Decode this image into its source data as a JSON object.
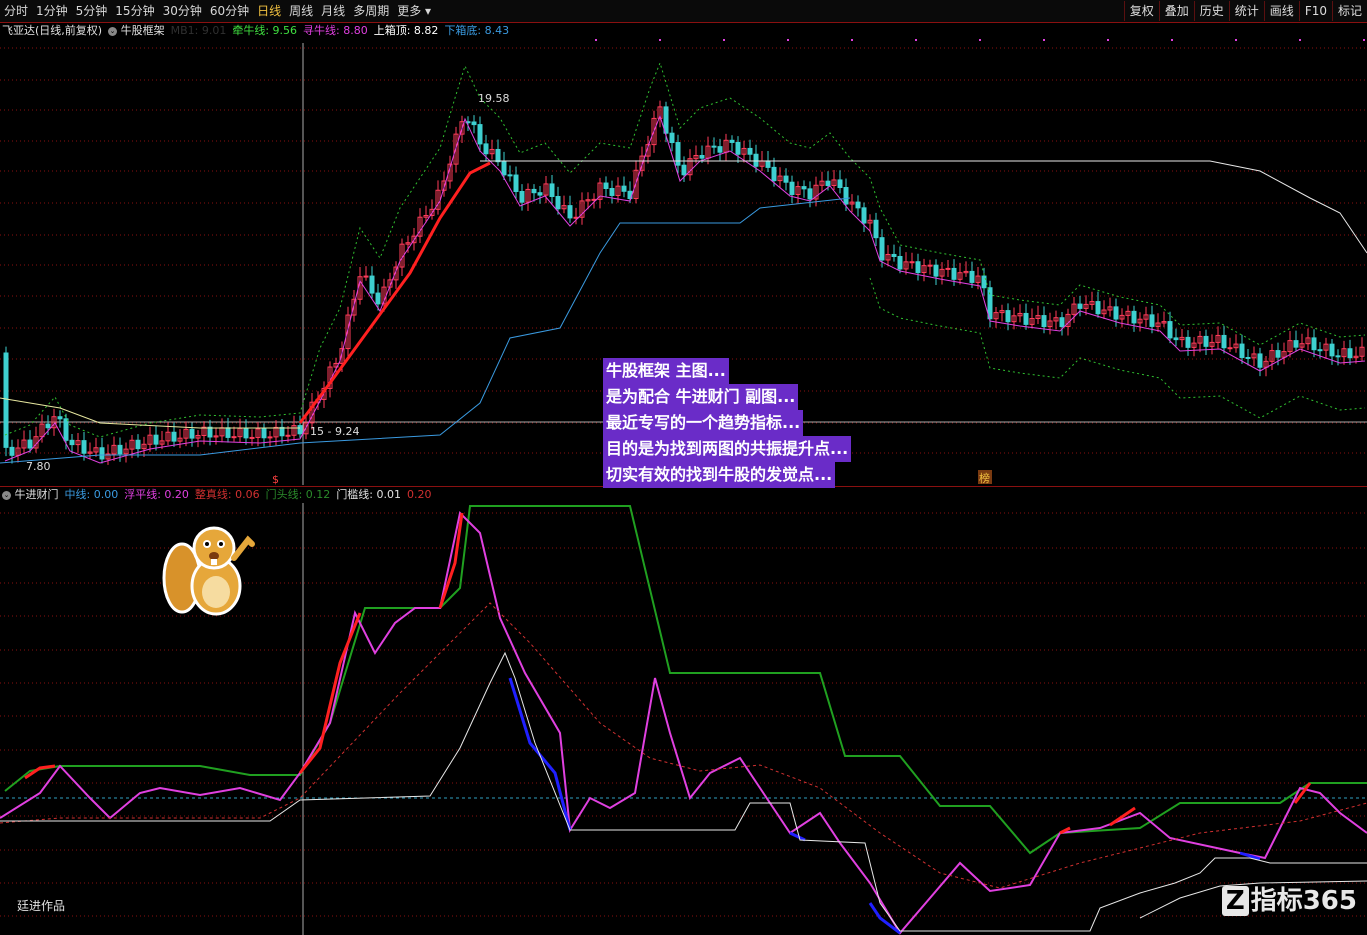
{
  "toolbar": {
    "periods": [
      "分时",
      "1分钟",
      "5分钟",
      "15分钟",
      "30分钟",
      "60分钟",
      "日线",
      "周线",
      "月线",
      "多周期",
      "更多"
    ],
    "active_period": "日线",
    "right_buttons": [
      "复权",
      "叠加",
      "历史",
      "统计",
      "画线",
      "F10",
      "标记"
    ]
  },
  "main_legend": {
    "stock": "飞亚达(日线,前复权)",
    "indicator": "牛股框架",
    "mb_label": "MB1: 9.01",
    "qianniu": "牵牛线: 9.56",
    "xunniu": "寻牛线: 8.80",
    "shangxiang": "上箱顶: 8.82",
    "xiaxiang": "下箱底: 8.43"
  },
  "main_chart": {
    "high_label": "19.58",
    "low_label": "7.80",
    "range_label": "15 - 9.24",
    "signal_tag": "$",
    "bang_tag": "榜"
  },
  "sub_legend": {
    "indicator": "牛进财门",
    "zhongxian": "中线: 0.00",
    "fuping": "浮平线: 0.20",
    "zhengzhen": "整真线: 0.06",
    "mentou": "门头线: 0.12",
    "menkan": "门槛线: 0.01",
    "extra": "0.20"
  },
  "overlay_text": [
    "牛股框架 主图...",
    "是为配合 牛进财门 副图...",
    "最近专写的一个趋势指标...",
    "目的是为找到两图的共振提升点...",
    "切实有效的找到牛股的发觉点..."
  ],
  "author": "廷进作品",
  "watermark": "指标365",
  "colors": {
    "up": "#ff3c5a",
    "down": "#3ed0d0",
    "qianniu": "#40e040",
    "xunniu": "#e040e0",
    "box_top": "#ffffff",
    "box_bottom": "#3a9ae0",
    "accent": "#f0c040",
    "overlay_bg": "#6a2cc8"
  }
}
